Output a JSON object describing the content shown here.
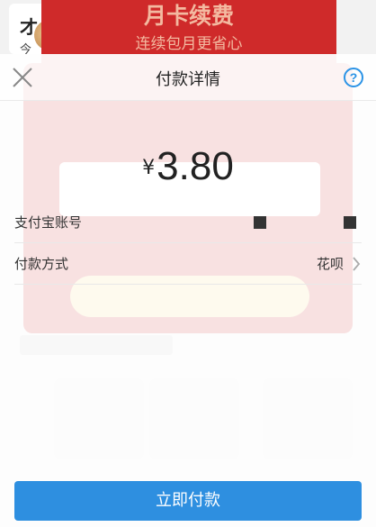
{
  "background": {
    "left_card_title": "才",
    "left_card_subtitle": "今",
    "banner_title": "月卡续费",
    "banner_subtitle": "连续包月更省心"
  },
  "dialog": {
    "title": "付款详情",
    "close_icon": "close-icon",
    "help_icon": "help-icon",
    "help_label": "?"
  },
  "payment": {
    "currency": "¥",
    "amount": "3.80",
    "account_label": "支付宝账号",
    "method_label": "付款方式",
    "method_value": "花呗"
  },
  "actions": {
    "pay_label": "立即付款"
  },
  "colors": {
    "accent": "#2e8fe0",
    "banner_red": "#cf2a2a"
  }
}
